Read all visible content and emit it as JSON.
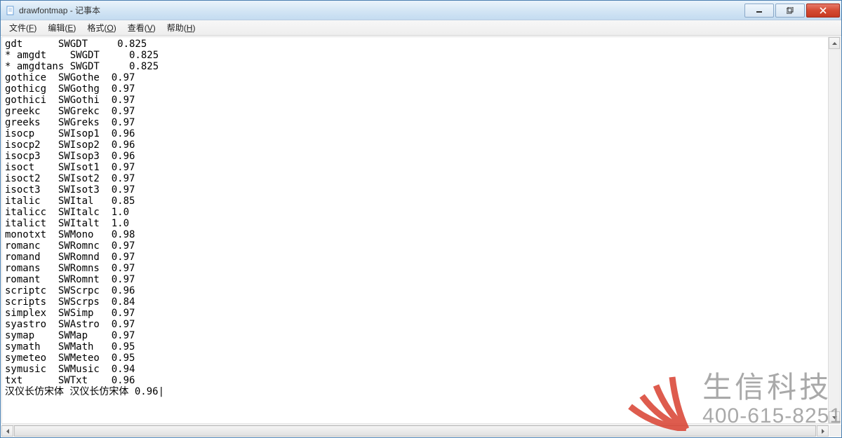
{
  "window": {
    "title": "drawfontmap - 记事本"
  },
  "menubar": {
    "items": [
      {
        "label": "文件",
        "accel": "F"
      },
      {
        "label": "编辑",
        "accel": "E"
      },
      {
        "label": "格式",
        "accel": "O"
      },
      {
        "label": "查看",
        "accel": "V"
      },
      {
        "label": "帮助",
        "accel": "H"
      }
    ]
  },
  "content": {
    "lines": [
      "gdt      SWGDT     0.825",
      "* amgdt    SWGDT     0.825",
      "* amgdtans SWGDT     0.825",
      "gothice  SWGothe  0.97",
      "gothicg  SWGothg  0.97",
      "gothici  SWGothi  0.97",
      "greekc   SWGrekc  0.97",
      "greeks   SWGreks  0.97",
      "isocp    SWIsop1  0.96",
      "isocp2   SWIsop2  0.96",
      "isocp3   SWIsop3  0.96",
      "isoct    SWIsot1  0.97",
      "isoct2   SWIsot2  0.97",
      "isoct3   SWIsot3  0.97",
      "italic   SWItal   0.85",
      "italicc  SWItalc  1.0",
      "italict  SWItalt  1.0",
      "monotxt  SWMono   0.98",
      "romanc   SWRomnc  0.97",
      "romand   SWRomnd  0.97",
      "romans   SWRomns  0.97",
      "romant   SWRomnt  0.97",
      "scriptc  SWScrpc  0.96",
      "scripts  SWScrps  0.84",
      "simplex  SWSimp   0.97",
      "syastro  SWAstro  0.97",
      "symap    SWMap    0.97",
      "symath   SWMath   0.95",
      "symeteo  SWMeteo  0.95",
      "symusic  SWMusic  0.94",
      "txt      SWTxt    0.96",
      "汉仪长仿宋体 汉仪长仿宋体 0.96"
    ]
  },
  "watermark": {
    "brand": "生信科技",
    "phone": "400-615-8251"
  }
}
